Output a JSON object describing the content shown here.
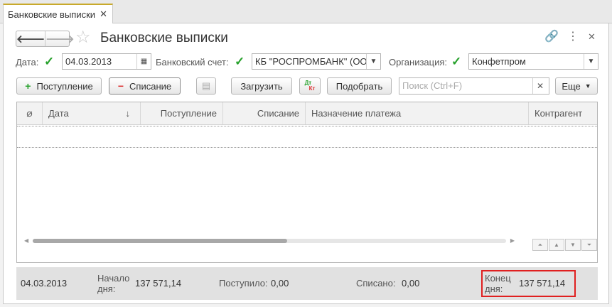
{
  "tab": {
    "title": "Банковские выписки",
    "close": "✕"
  },
  "form": {
    "title": "Банковские выписки"
  },
  "nav": {
    "back": "🡐",
    "forward": "🡒",
    "favorite": "☆"
  },
  "header_icons": {
    "link": "🔗",
    "menu": "⋮",
    "close": "✕"
  },
  "filters": {
    "date": {
      "label": "Дата:",
      "value": "04.03.2013",
      "checked": true
    },
    "account": {
      "label": "Банковский счет:",
      "value": "КБ \"РОСПРОМБАНК\" (ООО",
      "checked": true
    },
    "organization": {
      "label": "Организация:",
      "value": "Конфетпром",
      "checked": true
    }
  },
  "toolbar": {
    "receipt": "Поступление",
    "writeoff": "Списание",
    "load": "Загрузить",
    "dt_kt_top": "Дт",
    "dt_kt_bottom": "Кт",
    "select": "Подобрать",
    "search_placeholder": "Поиск (Ctrl+F)",
    "more": "Еще"
  },
  "table": {
    "columns": [
      "Дата",
      "Поступление",
      "Списание",
      "Назначение платежа",
      "Контрагент"
    ],
    "sort_indicator": "↓",
    "rows": []
  },
  "footer": {
    "date": "04.03.2013",
    "start_label_1": "Начало",
    "start_label_2": "дня:",
    "start_value": "137 571,14",
    "received_label": "Поступило:",
    "received_value": "0,00",
    "spent_label": "Списано:",
    "spent_value": "0,00",
    "end_label_1": "Конец",
    "end_label_2": "дня:",
    "end_value": "137 571,14"
  },
  "colors": {
    "accent_green": "#27a12c",
    "accent_red": "#d33333",
    "highlight": "#e02020",
    "tab_accent": "#c8a92b"
  }
}
